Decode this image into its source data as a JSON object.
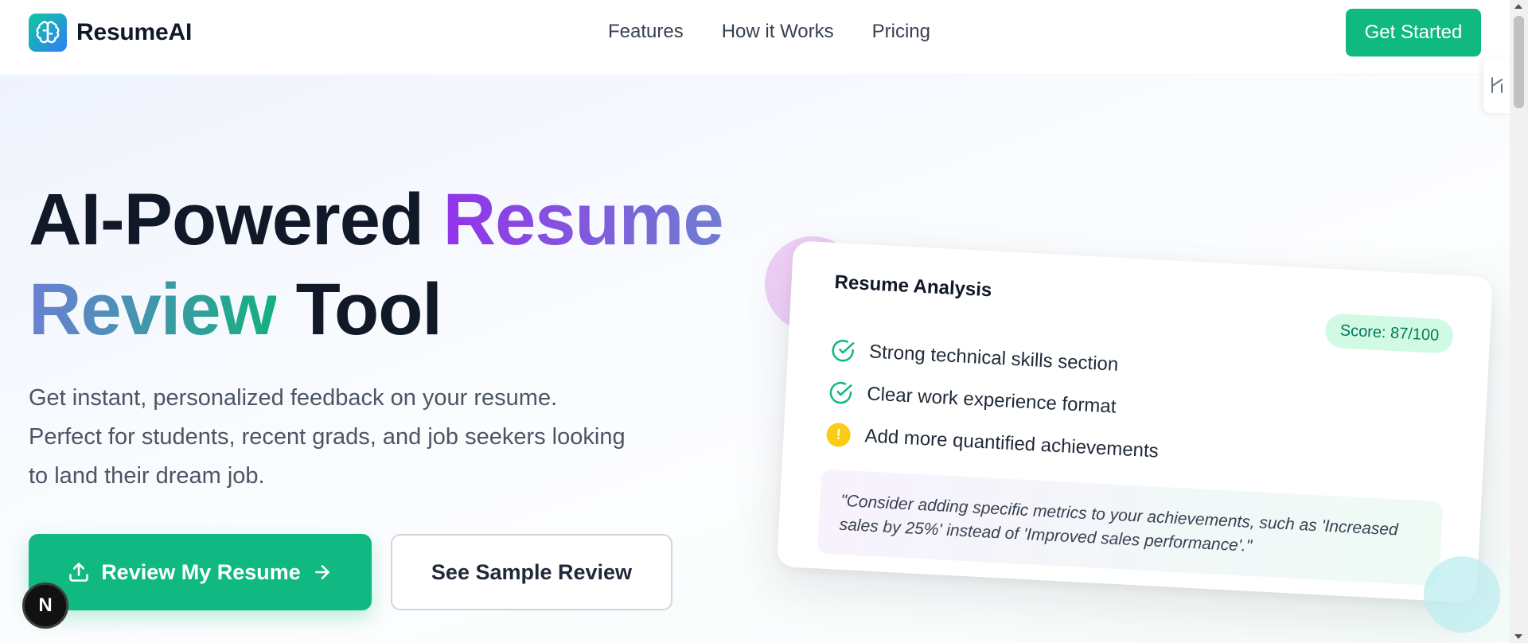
{
  "header": {
    "brand_name": "ResumeAI",
    "brand_icon": "brain-icon",
    "nav": [
      {
        "label": "Features"
      },
      {
        "label": "How it Works"
      },
      {
        "label": "Pricing"
      }
    ],
    "cta_label": "Get Started"
  },
  "hero": {
    "headline_part1": "AI-Powered ",
    "headline_accent1": "Resume",
    "headline_accent2": "Review",
    "headline_part2": " Tool",
    "subtext": "Get instant, personalized feedback on your resume. Perfect for students, recent grads, and job seekers looking to land their dream job.",
    "primary_button": "Review My Resume",
    "secondary_button": "See Sample Review"
  },
  "analysis_card": {
    "title": "Resume Analysis",
    "score": "Score: 87/100",
    "items": [
      {
        "text": "Strong technical skills section",
        "status": "check"
      },
      {
        "text": "Clear work experience format",
        "status": "check"
      },
      {
        "text": "Add more quantified achievements",
        "status": "warning"
      }
    ],
    "warning_symbol": "!",
    "quote": "\"Consider adding specific metrics to your achievements, such as 'Increased sales by 25%' instead of 'Improved sales performance'.\""
  },
  "dev_badge_letter": "N",
  "colors": {
    "brand": "#10b981",
    "gradient_start": "#9333ea",
    "gradient_end": "#10b981",
    "warning": "#facc15",
    "score_bg": "#d1fae5"
  }
}
